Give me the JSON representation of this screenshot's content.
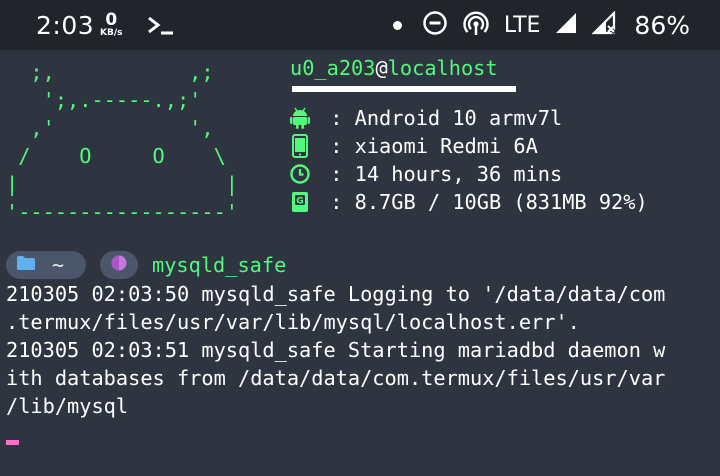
{
  "status_bar": {
    "time": "2:03",
    "net_speed_value": "0",
    "net_speed_unit": "KB/s",
    "prompt_glyph": ">_",
    "network_type": "LTE",
    "battery": "86%",
    "icons": [
      "terminal-icon",
      "dot-icon",
      "do-not-disturb-icon",
      "hotspot-icon",
      "signal-icon",
      "signal-x-icon"
    ]
  },
  "neofetch": {
    "ascii_art": "  ;,           ,;\n   ';,.-----.,;'\n  ,'           ',\n /    O     O    \\\n|                 |\n'-----------------'",
    "user": "u0_a203",
    "at": "@",
    "host": "localhost",
    "separator": " : ",
    "rows": [
      {
        "icon": "android-icon",
        "value": "Android 10 armv7l"
      },
      {
        "icon": "phone-icon",
        "value": "xiaomi Redmi 6A"
      },
      {
        "icon": "clock-icon",
        "value": "14 hours, 36 mins"
      },
      {
        "icon": "memory-icon",
        "value": "8.7GB / 10GB (831MB 92%)"
      }
    ]
  },
  "prompt": {
    "dir": "~",
    "command": "mysqld_safe"
  },
  "output": [
    "210305 02:03:50 mysqld_safe Logging to '/data/data/com",
    ".termux/files/usr/var/lib/mysql/localhost.err'.",
    "210305 02:03:51 mysqld_safe Starting mariadbd daemon w",
    "ith databases from /data/data/com.termux/files/usr/var",
    "/lib/mysql"
  ],
  "colors": {
    "background": "#2e3440",
    "status_bar": "#21252b",
    "accent_green": "#50fa7b",
    "folder_blue": "#61afef",
    "git_purple": "#c678dd",
    "cursor_pink": "#ff6ec7"
  }
}
